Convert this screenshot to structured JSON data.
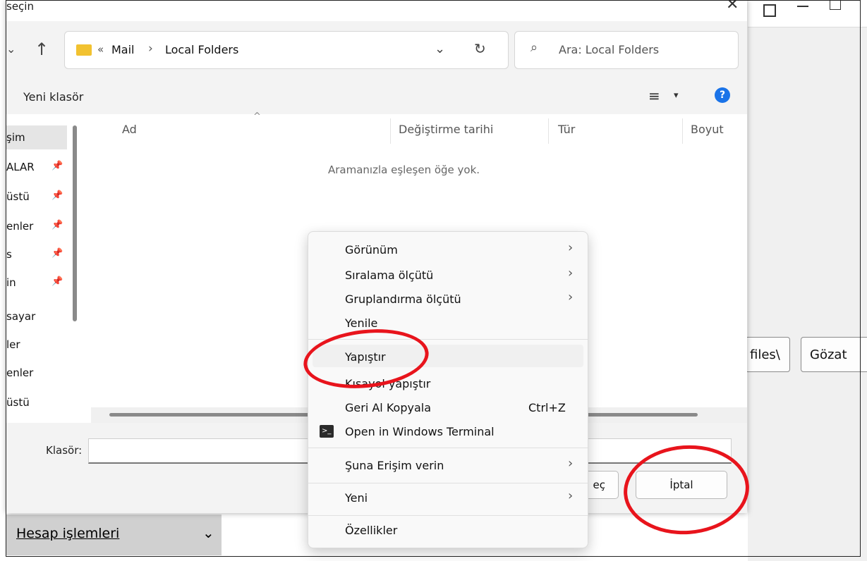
{
  "dialog": {
    "title": "seçin",
    "close_glyph": "✕",
    "breadcrumb": {
      "sep": "«",
      "items": [
        "Mail",
        "Local Folders"
      ],
      "chevron": "›"
    },
    "search_placeholder": "Ara: Local Folders",
    "toolbar": {
      "new_folder": "Yeni klasör",
      "view_glyph": "≡",
      "caret": "▾",
      "help": "?"
    },
    "sidebar": [
      {
        "label": "şim",
        "pinned": false
      },
      {
        "label": "ALAR",
        "pinned": true
      },
      {
        "label": "üstü",
        "pinned": true
      },
      {
        "label": "enler",
        "pinned": true
      },
      {
        "label": "s",
        "pinned": true
      },
      {
        "label": "in",
        "pinned": true
      },
      {
        "label": "sayar",
        "pinned": false
      },
      {
        "label": "ler",
        "pinned": false
      },
      {
        "label": "enler",
        "pinned": false
      },
      {
        "label": "üstü",
        "pinned": false
      }
    ],
    "columns": [
      "Ad",
      "Değiştirme tarihi",
      "Tür",
      "Boyut"
    ],
    "empty_message": "Aramanızla eşleşen öğe yok.",
    "folder_label": "Klasör:",
    "select_button": "eç",
    "cancel_button": "İptal"
  },
  "context_menu": {
    "items": [
      {
        "label": "Görünüm",
        "submenu": true
      },
      {
        "label": "Sıralama ölçütü",
        "submenu": true
      },
      {
        "label": "Gruplandırma ölçütü",
        "submenu": true
      },
      {
        "label": "Yenile",
        "submenu": false
      },
      {
        "label": "Yapıştır",
        "submenu": false
      },
      {
        "label": "Kısayol yapıştır",
        "submenu": false
      },
      {
        "label": "Geri Al Kopyala",
        "shortcut": "Ctrl+Z"
      },
      {
        "label": "Open in Windows Terminal",
        "submenu": false
      },
      {
        "label": "Şuna Erişim verin",
        "submenu": true
      },
      {
        "label": "Yeni",
        "submenu": true
      },
      {
        "label": "Özellikler",
        "submenu": false
      }
    ]
  },
  "background": {
    "files_button": "files\\",
    "browse_button": "Gözat",
    "account_button": "Hesap işlemleri",
    "account_caret": "⌄"
  },
  "colors": {
    "annotation": "#e8141c",
    "folder": "#f2c230",
    "help": "#1a73e8"
  }
}
